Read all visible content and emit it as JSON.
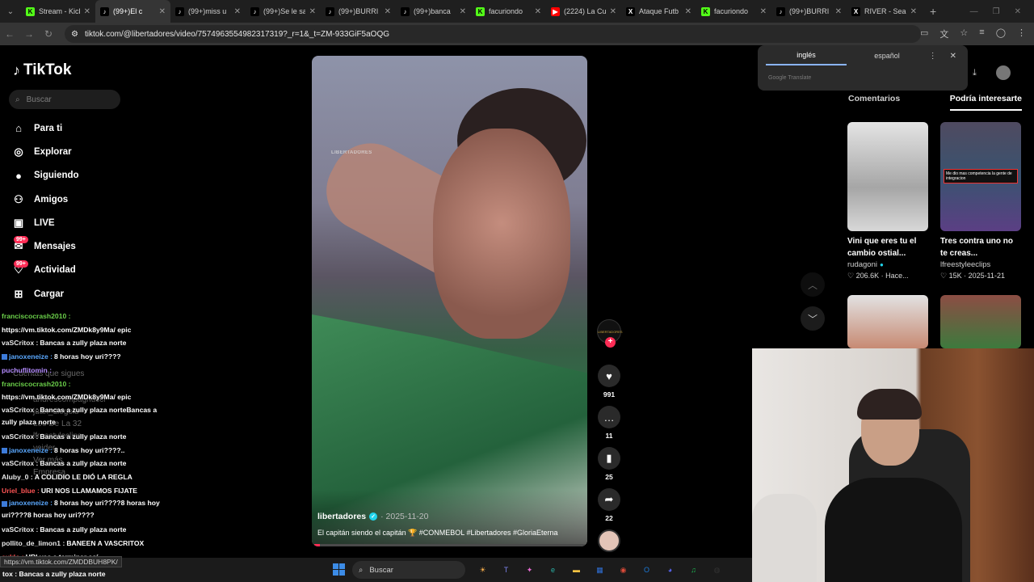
{
  "browser": {
    "tabs": [
      {
        "label": "Stream - Kick",
        "fav": "K",
        "favcolor": "#53fc18",
        "active": false
      },
      {
        "label": "(99+)El c",
        "fav": "♪",
        "favcolor": "#000000",
        "active": true
      },
      {
        "label": "(99+)miss u",
        "fav": "♪",
        "favcolor": "#000000",
        "active": false
      },
      {
        "label": "(99+)Se le sa",
        "fav": "♪",
        "favcolor": "#000000",
        "active": false
      },
      {
        "label": "(99+)BURRI",
        "fav": "♪",
        "favcolor": "#000000",
        "active": false
      },
      {
        "label": "(99+)banca",
        "fav": "♪",
        "favcolor": "#000000",
        "active": false
      },
      {
        "label": "facuriondo",
        "fav": "K",
        "favcolor": "#53fc18",
        "active": false
      },
      {
        "label": "(2224) La Cu",
        "fav": "▶",
        "favcolor": "#ff0000",
        "active": false
      },
      {
        "label": "Ataque Futb",
        "fav": "X",
        "favcolor": "#000000",
        "active": false
      },
      {
        "label": "facuriondo",
        "fav": "K",
        "favcolor": "#53fc18",
        "active": false
      },
      {
        "label": "(99+)BURRI",
        "fav": "♪",
        "favcolor": "#000000",
        "active": false
      },
      {
        "label": "RIVER - Sea",
        "fav": "X",
        "favcolor": "#000000",
        "active": false
      }
    ],
    "url": "tiktok.com/@libertadores/video/7574963554982317319?_r=1&_t=ZM-933GiF5aOQG"
  },
  "sidebar": {
    "logo": "TikTok",
    "search_placeholder": "Buscar",
    "items": [
      {
        "label": "Para ti",
        "icon": "home-icon",
        "glyph": "⌂",
        "badge": ""
      },
      {
        "label": "Explorar",
        "icon": "compass-icon",
        "glyph": "◎",
        "badge": ""
      },
      {
        "label": "Siguiendo",
        "icon": "following-avatar-icon",
        "glyph": "●",
        "badge": ""
      },
      {
        "label": "Amigos",
        "icon": "friends-icon",
        "glyph": "⚇",
        "badge": ""
      },
      {
        "label": "LIVE",
        "icon": "live-icon",
        "glyph": "▣",
        "badge": ""
      },
      {
        "label": "Mensajes",
        "icon": "messages-icon",
        "glyph": "✉",
        "badge": "99+"
      },
      {
        "label": "Actividad",
        "icon": "activity-icon",
        "glyph": "♡",
        "badge": "99+"
      },
      {
        "label": "Cargar",
        "icon": "upload-icon",
        "glyph": "⊞",
        "badge": ""
      }
    ],
    "ghost": {
      "following_header": "Cuentas que sigues",
      "accounts": [
        "andrescompagnucci",
        "juan_diegolb",
        "Leo De La 32",
        "lfreestyleclips",
        "veider",
        "Ver más",
        "Empresa"
      ]
    }
  },
  "chat": [
    {
      "user": "franciscocrash2010 :",
      "msg": "",
      "color": "u-g",
      "box": false
    },
    {
      "user": "",
      "msg": "https://vm.tiktok.com/ZMDk8y9Ma/ epic",
      "color": "u-y",
      "box": false
    },
    {
      "user": "vaSCritox :",
      "msg": "Bancas a zully plaza norte",
      "color": "u-y",
      "box": false
    },
    {
      "user": "janoxeneize :",
      "msg": "8 horas hoy uri????",
      "color": "u-b",
      "box": true
    },
    {
      "user": "puchuflitomin :",
      "msg": "",
      "color": "u-p",
      "box": false
    },
    {
      "user": "franciscocrash2010 :",
      "msg": "",
      "color": "u-g",
      "box": false
    },
    {
      "user": "",
      "msg": "https://vm.tiktok.com/ZMDk8y9Ma/ epic",
      "color": "u-y",
      "box": false
    },
    {
      "user": "vaSCritox :",
      "msg": "Bancas a zully plaza norteBancas a zully plaza norte",
      "color": "u-y",
      "box": false,
      "wrap": true
    },
    {
      "user": "vaSCritox :",
      "msg": "Bancas a zully plaza norte",
      "color": "u-y",
      "box": false
    },
    {
      "user": "janoxeneize :",
      "msg": "8 horas hoy uri????..",
      "color": "u-b",
      "box": true
    },
    {
      "user": "vaSCritox :",
      "msg": "Bancas a zully plaza norte",
      "color": "u-y",
      "box": false
    },
    {
      "user": "Aluby_0 :",
      "msg": "A COLIDIO LE DIÓ LA REGLA",
      "color": "u-y",
      "box": false
    },
    {
      "user": "Uriel_blue :",
      "msg": "URI NOS LLAMAMOS FIJATE",
      "color": "u-r",
      "box": false
    },
    {
      "user": "janoxeneize :",
      "msg": "8 horas hoy uri????8 horas hoy uri????8 horas hoy uri????",
      "color": "u-b",
      "box": true,
      "wrap": true
    },
    {
      "user": "vaSCritox :",
      "msg": "Bancas a zully plaza norte",
      "color": "u-y",
      "box": false
    },
    {
      "user": "pollito_de_limon1 :",
      "msg": "BANEEN A VASCRITOX",
      "color": "u-y",
      "box": false
    },
    {
      "user": "cuklo :",
      "msg": "URI vas a terminar así",
      "color": "u-r",
      "box": false
    }
  ],
  "status_url": "https://vm.tiktok.com/ZMDDBUH8PK/",
  "bottom_chat": "tox : Bancas a zully plaza norte",
  "video": {
    "watermark": "LIBERTADORES",
    "username": "libertadores",
    "date": "· 2025-11-20",
    "caption": "El capitán siendo el capitán 🏆 #CONMEBOL #Libertadores #GloriaEterna",
    "progress_fraction": 0.02
  },
  "rail": {
    "avatar_text": "LIBERTADORES",
    "likes": "991",
    "comments": "11",
    "saves": "25",
    "shares": "22"
  },
  "translate": {
    "lang_from": "inglés",
    "lang_to": "español",
    "brand": "Google Translate"
  },
  "right_panel": {
    "tabs": [
      "Comentarios",
      "Podría interesarte"
    ],
    "cards": [
      {
        "title": "Vini que eres tu el cambio ostial...",
        "user": "rudagoni",
        "verified": true,
        "meta": "♡ 206.6K · Hace..."
      },
      {
        "title": "Tres contra uno no te creas...",
        "user": "lfreestyleeclips",
        "verified": false,
        "meta": "♡ 15K · 2025-11-21",
        "overlay": "Me dio mas competencia la gente de integracion"
      },
      {
        "title": "",
        "user": "",
        "verified": false,
        "meta": ""
      },
      {
        "title": "",
        "user": "",
        "verified": false,
        "meta": ""
      }
    ]
  },
  "taskbar": {
    "search_placeholder": "Buscar",
    "apps": [
      {
        "name": "widgets-icon",
        "color": "#ffb34d",
        "glyph": "☀"
      },
      {
        "name": "teams-icon",
        "color": "#7b83eb",
        "glyph": "T"
      },
      {
        "name": "copilot-icon",
        "color": "#e76bd3",
        "glyph": "✦"
      },
      {
        "name": "edge-icon",
        "color": "#2bb3a8",
        "glyph": "e"
      },
      {
        "name": "file-explorer-icon",
        "color": "#f5c242",
        "glyph": "▬"
      },
      {
        "name": "store-icon",
        "color": "#2f6fd6",
        "glyph": "▦"
      },
      {
        "name": "chrome-icon",
        "color": "#dd4b39",
        "glyph": "◉"
      },
      {
        "name": "outlook-icon",
        "color": "#1b78d6",
        "glyph": "O"
      },
      {
        "name": "discord-icon",
        "color": "#5865f2",
        "glyph": "◕"
      },
      {
        "name": "spotify-icon",
        "color": "#1db954",
        "glyph": "♫"
      },
      {
        "name": "obs-icon",
        "color": "#333333",
        "glyph": "◍"
      }
    ]
  }
}
